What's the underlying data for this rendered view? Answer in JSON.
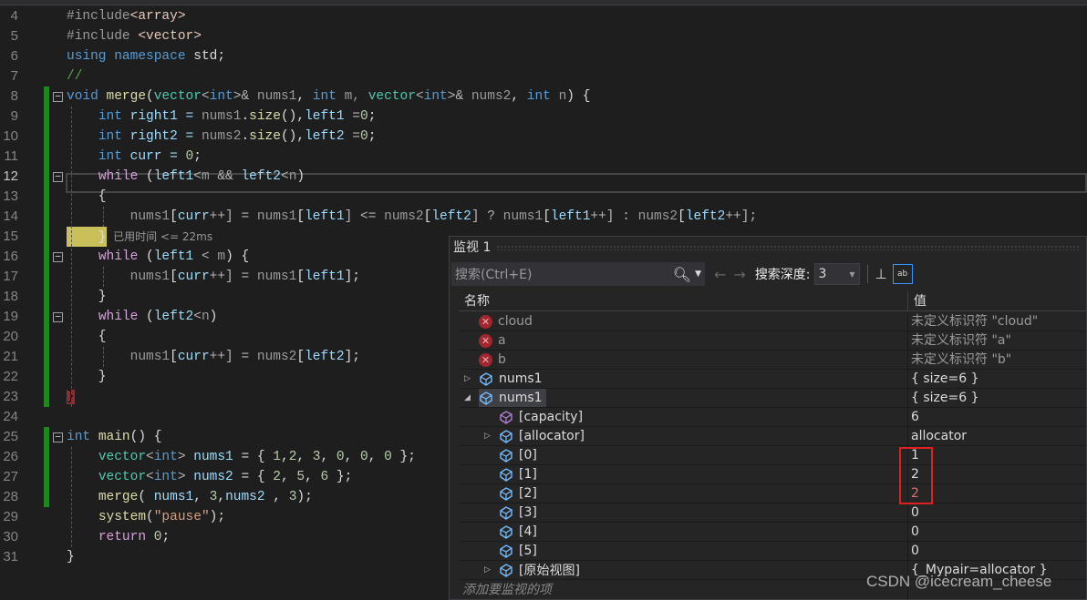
{
  "editor": {
    "first_line": 4,
    "current_line": 12,
    "lines": [
      [
        [
          "#include",
          "pp"
        ],
        [
          "<array>",
          "inc"
        ]
      ],
      [
        [
          "#include ",
          "pp"
        ],
        [
          "<vector>",
          "inc"
        ]
      ],
      [
        [
          "using",
          "k"
        ],
        [
          " ",
          "w"
        ],
        [
          "namespace",
          "k"
        ],
        [
          " std;",
          "w"
        ]
      ],
      [
        [
          "//",
          "cm"
        ]
      ],
      [
        [
          "void",
          "k"
        ],
        [
          " ",
          "w"
        ],
        [
          "merge",
          "f"
        ],
        [
          "(",
          "w"
        ],
        [
          "vector",
          "t"
        ],
        [
          "<",
          "o"
        ],
        [
          "int",
          "k"
        ],
        [
          ">& ",
          "o"
        ],
        [
          "nums1",
          "pm"
        ],
        [
          ", ",
          "w"
        ],
        [
          "int",
          "k"
        ],
        [
          " m, ",
          "pm"
        ],
        [
          "vector",
          "t"
        ],
        [
          "<",
          "o"
        ],
        [
          "int",
          "k"
        ],
        [
          ">& ",
          "o"
        ],
        [
          "nums2",
          "pm"
        ],
        [
          ", ",
          "w"
        ],
        [
          "int",
          "k"
        ],
        [
          " n",
          "pm"
        ],
        [
          ") {",
          "w"
        ]
      ],
      [
        [
          "    ",
          "w"
        ],
        [
          "int",
          "k"
        ],
        [
          " right1 = ",
          "v"
        ],
        [
          "nums1",
          "pm"
        ],
        [
          ".",
          "w"
        ],
        [
          "size",
          "f"
        ],
        [
          "(),",
          "w"
        ],
        [
          "left1",
          "v"
        ],
        [
          " =",
          "o"
        ],
        [
          "0",
          "n"
        ],
        [
          ";",
          "w"
        ]
      ],
      [
        [
          "    ",
          "w"
        ],
        [
          "int",
          "k"
        ],
        [
          " right2 = ",
          "v"
        ],
        [
          "nums2",
          "pm"
        ],
        [
          ".",
          "w"
        ],
        [
          "size",
          "f"
        ],
        [
          "(),",
          "w"
        ],
        [
          "left2",
          "v"
        ],
        [
          " =",
          "o"
        ],
        [
          "0",
          "n"
        ],
        [
          ";",
          "w"
        ]
      ],
      [
        [
          "    ",
          "w"
        ],
        [
          "int",
          "k"
        ],
        [
          " curr = ",
          "v"
        ],
        [
          "0",
          "n"
        ],
        [
          ";",
          "w"
        ]
      ],
      [
        [
          "    ",
          "w"
        ],
        [
          "while",
          "c"
        ],
        [
          " (",
          "w"
        ],
        [
          "left1",
          "v"
        ],
        [
          "<",
          "o"
        ],
        [
          "m",
          "pm"
        ],
        [
          " && ",
          "o"
        ],
        [
          "left2",
          "v"
        ],
        [
          "<",
          "o"
        ],
        [
          "n",
          "pm"
        ],
        [
          ")",
          "w"
        ]
      ],
      [
        [
          "    {",
          "w"
        ]
      ],
      [
        [
          "        ",
          "w"
        ],
        [
          "nums1",
          "pm"
        ],
        [
          "[",
          "w"
        ],
        [
          "curr",
          "v"
        ],
        [
          "++] = ",
          "o"
        ],
        [
          "nums1",
          "pm"
        ],
        [
          "[",
          "w"
        ],
        [
          "left1",
          "v"
        ],
        [
          "] <= ",
          "o"
        ],
        [
          "nums2",
          "pm"
        ],
        [
          "[",
          "w"
        ],
        [
          "left2",
          "v"
        ],
        [
          "] ? ",
          "o"
        ],
        [
          "nums1",
          "pm"
        ],
        [
          "[",
          "w"
        ],
        [
          "left1",
          "v"
        ],
        [
          "++] : ",
          "o"
        ],
        [
          "nums2",
          "pm"
        ],
        [
          "[",
          "w"
        ],
        [
          "left2",
          "v"
        ],
        [
          "++];",
          "o"
        ]
      ],
      [
        [
          "    }",
          "w"
        ],
        [
          "  已用时间 <= 22ms",
          "hint"
        ]
      ],
      [
        [
          "    ",
          "w"
        ],
        [
          "while",
          "c"
        ],
        [
          " (",
          "w"
        ],
        [
          "left1",
          "v"
        ],
        [
          " < ",
          "o"
        ],
        [
          "m",
          "pm"
        ],
        [
          ") {",
          "w"
        ]
      ],
      [
        [
          "        ",
          "w"
        ],
        [
          "nums1",
          "pm"
        ],
        [
          "[",
          "w"
        ],
        [
          "curr",
          "v"
        ],
        [
          "++] = ",
          "o"
        ],
        [
          "nums1",
          "pm"
        ],
        [
          "[",
          "w"
        ],
        [
          "left1",
          "v"
        ],
        [
          "];",
          "w"
        ]
      ],
      [
        [
          "    }",
          "w"
        ]
      ],
      [
        [
          "    ",
          "w"
        ],
        [
          "while",
          "c"
        ],
        [
          " (",
          "w"
        ],
        [
          "left2",
          "v"
        ],
        [
          "<",
          "o"
        ],
        [
          "n",
          "pm"
        ],
        [
          ")",
          "w"
        ]
      ],
      [
        [
          "    {",
          "w"
        ]
      ],
      [
        [
          "        ",
          "w"
        ],
        [
          "nums1",
          "pm"
        ],
        [
          "[",
          "w"
        ],
        [
          "curr",
          "v"
        ],
        [
          "++] = ",
          "o"
        ],
        [
          "nums2",
          "pm"
        ],
        [
          "[",
          "w"
        ],
        [
          "left2",
          "v"
        ],
        [
          "];",
          "w"
        ]
      ],
      [
        [
          "    }",
          "w"
        ]
      ],
      [
        [
          "}",
          "redbrace"
        ]
      ],
      [],
      [
        [
          "int",
          "k"
        ],
        [
          " ",
          "w"
        ],
        [
          "main",
          "f"
        ],
        [
          "() {",
          "w"
        ]
      ],
      [
        [
          "    ",
          "w"
        ],
        [
          "vector",
          "t"
        ],
        [
          "<",
          "o"
        ],
        [
          "int",
          "k"
        ],
        [
          "> ",
          "o"
        ],
        [
          "nums1",
          "v"
        ],
        [
          " = { ",
          "w"
        ],
        [
          "1",
          "n"
        ],
        [
          ",",
          "w"
        ],
        [
          "2",
          "n"
        ],
        [
          ", ",
          "w"
        ],
        [
          "3",
          "n"
        ],
        [
          ", ",
          "w"
        ],
        [
          "0",
          "n"
        ],
        [
          ", ",
          "w"
        ],
        [
          "0",
          "n"
        ],
        [
          ", ",
          "w"
        ],
        [
          "0",
          "n"
        ],
        [
          " };",
          "w"
        ]
      ],
      [
        [
          "    ",
          "w"
        ],
        [
          "vector",
          "t"
        ],
        [
          "<",
          "o"
        ],
        [
          "int",
          "k"
        ],
        [
          "> ",
          "o"
        ],
        [
          "nums2",
          "v"
        ],
        [
          " = { ",
          "w"
        ],
        [
          "2",
          "n"
        ],
        [
          ", ",
          "w"
        ],
        [
          "5",
          "n"
        ],
        [
          ", ",
          "w"
        ],
        [
          "6",
          "n"
        ],
        [
          " };",
          "w"
        ]
      ],
      [
        [
          "    ",
          "w"
        ],
        [
          "merge",
          "f"
        ],
        [
          "( ",
          "w"
        ],
        [
          "nums1",
          "v"
        ],
        [
          ", ",
          "w"
        ],
        [
          "3",
          "n"
        ],
        [
          ",",
          "w"
        ],
        [
          "nums2",
          "v"
        ],
        [
          " , ",
          "w"
        ],
        [
          "3",
          "n"
        ],
        [
          ");",
          "w"
        ]
      ],
      [
        [
          "    ",
          "w"
        ],
        [
          "system",
          "f"
        ],
        [
          "(",
          "w"
        ],
        [
          "\"pause\"",
          "s"
        ],
        [
          ");",
          "w"
        ]
      ],
      [
        [
          "    ",
          "w"
        ],
        [
          "return",
          "c"
        ],
        [
          " ",
          "w"
        ],
        [
          "0",
          "n"
        ],
        [
          ";",
          "w"
        ]
      ],
      [
        [
          "}",
          "w"
        ]
      ]
    ]
  },
  "watch": {
    "title": "监视 1",
    "search_placeholder": "搜索(Ctrl+E)",
    "depth_label": "搜索深度:",
    "depth_value": "3",
    "col_name": "名称",
    "col_value": "值",
    "add_placeholder": "添加要监视的项",
    "rows": [
      {
        "name": "cloud",
        "value": "未定义标识符 \"cloud\"",
        "icon": "error-icon",
        "indent": 0,
        "expander": "none",
        "err": true
      },
      {
        "name": "a",
        "value": "未定义标识符 \"a\"",
        "icon": "error-icon",
        "indent": 0,
        "expander": "none",
        "err": true
      },
      {
        "name": "b",
        "value": "未定义标识符 \"b\"",
        "icon": "error-icon",
        "indent": 0,
        "expander": "none",
        "err": true
      },
      {
        "name": "nums1",
        "value": "{ size=6 }",
        "icon": "variable-icon",
        "indent": 0,
        "expander": "collapsed"
      },
      {
        "name": "nums1",
        "value": "{ size=6 }",
        "icon": "variable-icon",
        "indent": 0,
        "expander": "expanded",
        "selected": true
      },
      {
        "name": "[capacity]",
        "value": "6",
        "icon": "property-icon",
        "indent": 1,
        "expander": "none"
      },
      {
        "name": "[allocator]",
        "value": "allocator",
        "icon": "variable-icon",
        "indent": 1,
        "expander": "collapsed"
      },
      {
        "name": "[0]",
        "value": "1",
        "icon": "variable-icon",
        "indent": 1,
        "expander": "none"
      },
      {
        "name": "[1]",
        "value": "2",
        "icon": "variable-icon",
        "indent": 1,
        "expander": "none"
      },
      {
        "name": "[2]",
        "value": "2",
        "icon": "variable-icon",
        "indent": 1,
        "expander": "none",
        "changed": true
      },
      {
        "name": "[3]",
        "value": "0",
        "icon": "variable-icon",
        "indent": 1,
        "expander": "none"
      },
      {
        "name": "[4]",
        "value": "0",
        "icon": "variable-icon",
        "indent": 1,
        "expander": "none"
      },
      {
        "name": "[5]",
        "value": "0",
        "icon": "variable-icon",
        "indent": 1,
        "expander": "none"
      },
      {
        "name": "[原始视图]",
        "value": "{_Mypair=allocator }",
        "icon": "variable-icon",
        "indent": 1,
        "expander": "collapsed"
      }
    ]
  },
  "watermark": "CSDN @icecream_cheese",
  "colors": {
    "highlight_box": "#e02020",
    "changed_value": "#e07070",
    "breakpoint_bar": "#c9c05a"
  }
}
